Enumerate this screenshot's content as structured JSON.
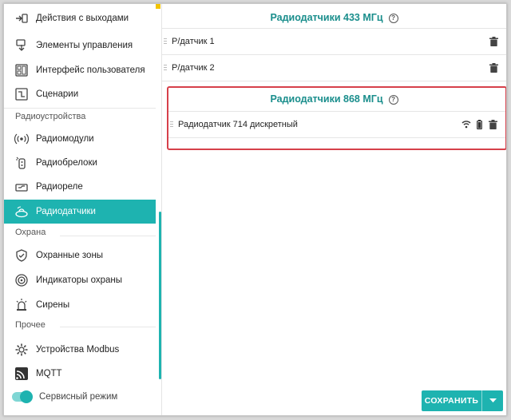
{
  "sidebar": {
    "items": [
      {
        "label": "Действия с выходами",
        "icon": "outputs-actions-icon"
      },
      {
        "label": "Элементы управления",
        "icon": "controls-icon"
      },
      {
        "label": "Интерфейс пользователя",
        "icon": "user-interface-icon"
      },
      {
        "label": "Сценарии",
        "icon": "scenarios-icon"
      },
      {
        "label": "Радиомодули",
        "icon": "radio-module-icon"
      },
      {
        "label": "Радиобрелоки",
        "icon": "key-fob-icon"
      },
      {
        "label": "Радиореле",
        "icon": "radio-relay-icon"
      },
      {
        "label": "Радиодатчики",
        "icon": "radio-sensor-icon"
      },
      {
        "label": "Охранные зоны",
        "icon": "shield-icon"
      },
      {
        "label": "Индикаторы охраны",
        "icon": "security-indicator-icon"
      },
      {
        "label": "Сирены",
        "icon": "siren-icon"
      },
      {
        "label": "Устройства Modbus",
        "icon": "modbus-gear-icon"
      },
      {
        "label": "MQTT",
        "icon": "mqtt-icon"
      }
    ],
    "sections": {
      "radio": "Радиоустройства",
      "security": "Охрана",
      "other": "Прочее"
    },
    "service_mode": "Сервисный режим"
  },
  "main": {
    "panel433": {
      "title": "Радиодатчики 433 МГц",
      "rows": [
        "Р/датчик 1",
        "Р/датчик 2"
      ]
    },
    "panel868": {
      "title": "Радиодатчики 868 МГц",
      "rows": [
        "Радиодатчик 714 дискретный"
      ]
    },
    "save_label": "СОХРАНИТЬ"
  },
  "colors": {
    "accent": "#1eb3b0",
    "title": "#1a8e8c",
    "highlight": "#d6404a"
  }
}
